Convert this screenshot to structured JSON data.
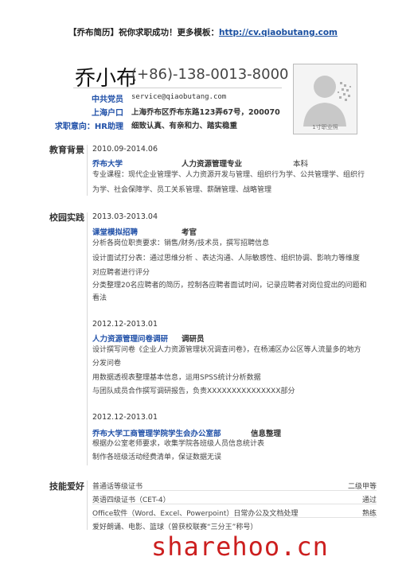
{
  "banner": {
    "prefix": "【乔布简历】祝你求职成功！更多模板：",
    "link": "http://cv.qiaobutang.com"
  },
  "header": {
    "name": "乔小布",
    "phone": "(+86)-138-0013-8000",
    "fields": [
      {
        "label": "中共党员",
        "value": "service@qiaobutang.com"
      },
      {
        "label": "上海户口",
        "value": "上海乔布区乔布东路123弄67号，200070"
      },
      {
        "label": "求职意向：HR助理",
        "value": "细致认真、有亲和力、踏实稳重"
      }
    ],
    "photo_caption": "1寸职业照"
  },
  "education": {
    "title": "教育背景",
    "date": "2010.09-2014.06",
    "school": "乔布大学",
    "major": "人力资源管理专业",
    "degree": "本科",
    "courses_line1": "专业课程：现代企业管理学、人力资源开发与管理、组织行为学、公共管理学、组织行",
    "courses_line2": "为学、社会保障学、员工关系管理、薪酬管理、战略管理"
  },
  "campus": {
    "title": "校园实践",
    "items": [
      {
        "date": "2013.03-2013.04",
        "org": "课堂模拟招聘",
        "role": "考官",
        "lines": [
          "分析各岗位职责要求：销售/财务/技术员，撰写招聘信息",
          "设计面试打分表：通过思维分析  、表达沟通、人际敏感性、组织协调、影响力等维度",
          "对应聘者进行评分",
          "分类整理20名应聘者的简历，控制各应聘者面试时间，记录应聘者对岗位提出的问题和",
          "看法"
        ]
      },
      {
        "date": "2012.12-2013.01",
        "org": "人力资源管理问卷调研",
        "role": "调研员",
        "lines": [
          "设计撰写问卷《企业人力资源管理状况调查问卷》，在杨浦区办公区等人流量多的地方",
          "分发问卷",
          "用数据透视表整理基本信息，运用SPSS统计分析数据",
          "与团队成员合作撰写调研报告，负责XXXXXXXXXXXXXXX部分"
        ]
      },
      {
        "date": "2012.12-2013.01",
        "org": "乔布大学工商管理学院学生会办公室部",
        "role": "信息整理",
        "lines": [
          "根据办公室老师要求，收集学院各班级人员信息统计表",
          "制作各班级活动经费清单，保证数据无误"
        ]
      }
    ]
  },
  "skills": {
    "title": "技能爱好",
    "items": [
      {
        "name": "普通话等级证书",
        "level": "二级甲等"
      },
      {
        "name": "英语四级证书（CET-4）",
        "level": "通过"
      },
      {
        "name": "Office软件（Word、Excel、Powerpoint）日常办公及文档处理",
        "level": "熟练"
      },
      {
        "name": "爱好朗诵、电影、篮球（曾获校联赛“三分王”称号）",
        "level": ""
      }
    ]
  },
  "watermark": "sharehoo.cn"
}
